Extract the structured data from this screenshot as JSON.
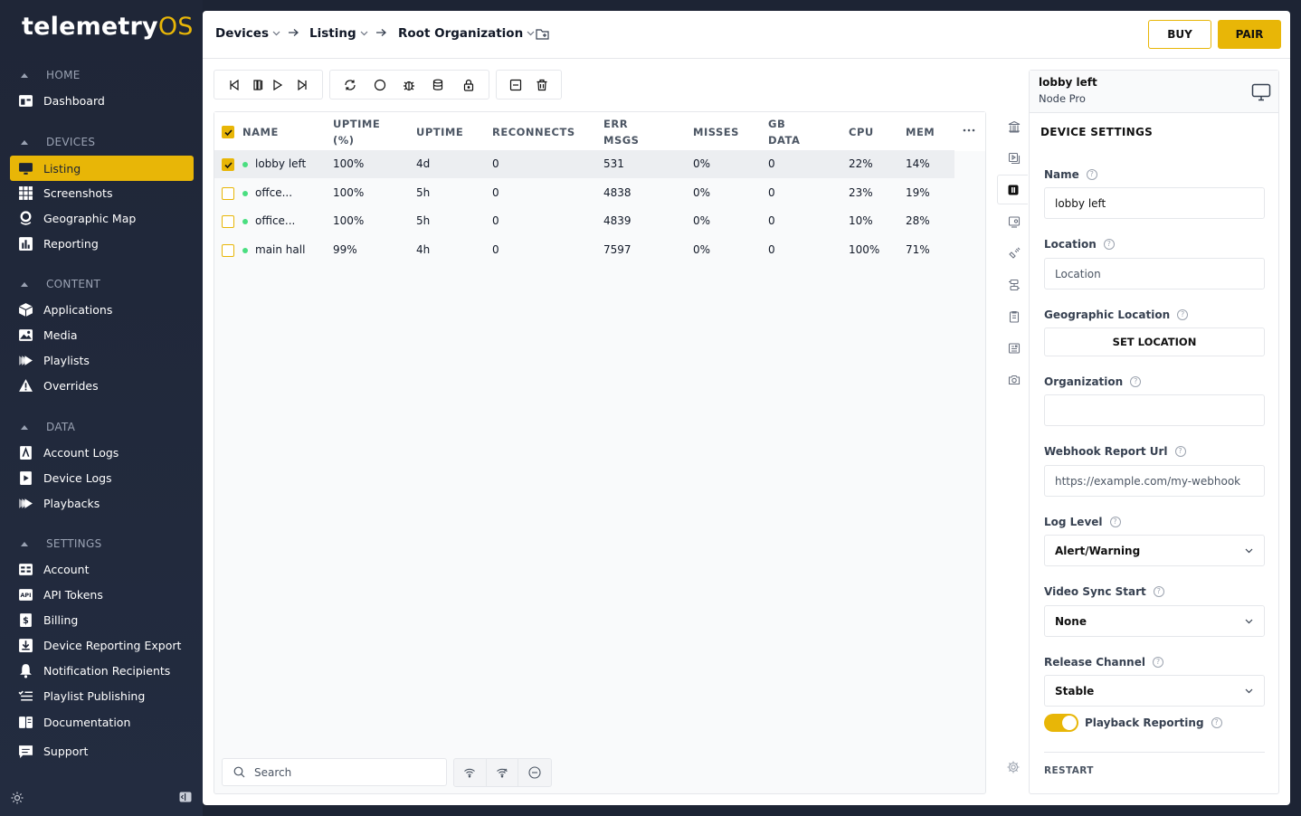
{
  "brand": {
    "name_part1": "telemetry",
    "name_part2": "OS",
    "accent": "#e8b607"
  },
  "sidebar": {
    "sections": [
      {
        "label": "HOME"
      },
      {
        "label": "DEVICES"
      },
      {
        "label": "CONTENT"
      },
      {
        "label": "DATA"
      },
      {
        "label": "SETTINGS"
      }
    ],
    "items": [
      {
        "label": "Dashboard",
        "icon": "dashboard-icon"
      },
      {
        "label": "Listing",
        "icon": "monitor-icon",
        "active": true
      },
      {
        "label": "Screenshots",
        "icon": "grid-icon"
      },
      {
        "label": "Geographic Map",
        "icon": "map-pin-icon"
      },
      {
        "label": "Reporting",
        "icon": "bar-chart-icon"
      },
      {
        "label": "Applications",
        "icon": "cube-icon"
      },
      {
        "label": "Media",
        "icon": "image-icon"
      },
      {
        "label": "Playlists",
        "icon": "playlist-icon"
      },
      {
        "label": "Overrides",
        "icon": "warning-icon"
      },
      {
        "label": "Account Logs",
        "icon": "account-log-icon"
      },
      {
        "label": "Device Logs",
        "icon": "device-log-icon"
      },
      {
        "label": "Playbacks",
        "icon": "playback-icon"
      },
      {
        "label": "Account",
        "icon": "account-icon"
      },
      {
        "label": "API Tokens",
        "icon": "api-icon"
      },
      {
        "label": "Billing",
        "icon": "billing-icon"
      },
      {
        "label": "Device Reporting Export",
        "icon": "download-icon"
      },
      {
        "label": "Notification Recipients",
        "icon": "bell-icon"
      },
      {
        "label": "Playlist Publishing",
        "icon": "list-check-icon"
      },
      {
        "label": "Documentation",
        "icon": "book-icon"
      },
      {
        "label": "Support",
        "icon": "chat-icon"
      }
    ]
  },
  "breadcrumb": {
    "items": [
      "Devices",
      "Listing",
      "Root Organization"
    ]
  },
  "header": {
    "buy_label": "BUY",
    "pair_label": "PAIR"
  },
  "table": {
    "columns": [
      "NAME",
      "UPTIME (%)",
      "UPTIME",
      "RECONNECTS",
      "ERR MSGS",
      "MISSES",
      "GB DATA",
      "CPU",
      "MEM"
    ],
    "rows": [
      {
        "name": "lobby left",
        "uptime_pct": "100%",
        "uptime": "4d",
        "reconnects": "0",
        "err_msgs": "531",
        "misses": "0%",
        "gb_data": "0",
        "cpu": "22%",
        "mem": "14%",
        "selected": true
      },
      {
        "name": "offce...",
        "uptime_pct": "100%",
        "uptime": "5h",
        "reconnects": "0",
        "err_msgs": "4838",
        "misses": "0%",
        "gb_data": "0",
        "cpu": "23%",
        "mem": "19%",
        "selected": false
      },
      {
        "name": "office...",
        "uptime_pct": "100%",
        "uptime": "5h",
        "reconnects": "0",
        "err_msgs": "4839",
        "misses": "0%",
        "gb_data": "0",
        "cpu": "10%",
        "mem": "28%",
        "selected": false
      },
      {
        "name": "main hall",
        "uptime_pct": "99%",
        "uptime": "4h",
        "reconnects": "0",
        "err_msgs": "7597",
        "misses": "0%",
        "gb_data": "0",
        "cpu": "100%",
        "mem": "71%",
        "selected": false
      }
    ],
    "search_placeholder": "Search"
  },
  "device": {
    "name": "lobby left",
    "type": "Node Pro",
    "settings_title": "DEVICE SETTINGS",
    "fields": {
      "name_label": "Name",
      "name_value": "lobby left",
      "location_label": "Location",
      "location_placeholder": "Location",
      "geo_label": "Geographic Location",
      "geo_button": "SET LOCATION",
      "org_label": "Organization",
      "org_value": "",
      "webhook_label": "Webhook Report Url",
      "webhook_placeholder": "https://example.com/my-webhook",
      "log_label": "Log Level",
      "log_value": "Alert/Warning",
      "sync_label": "Video Sync Start",
      "sync_value": "None",
      "release_label": "Release Channel",
      "release_value": "Stable",
      "playback_label": "Playback Reporting",
      "playback_on": true,
      "restart_label": "RESTART"
    }
  }
}
